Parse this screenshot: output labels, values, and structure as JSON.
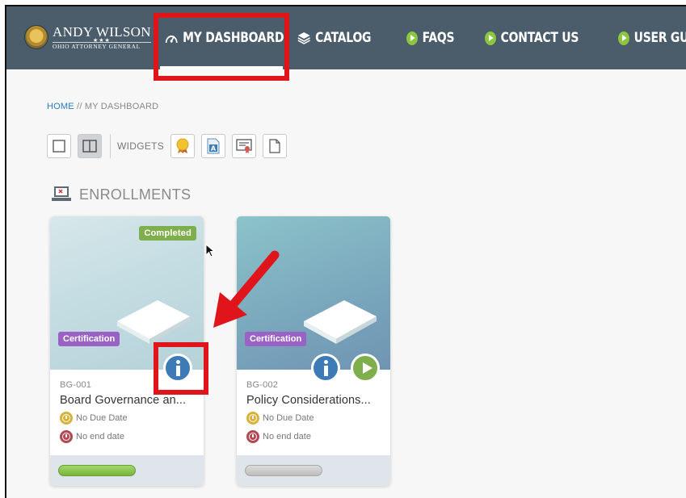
{
  "header": {
    "logo_name": "ANDY WILSON",
    "logo_stars": "★★★",
    "logo_subtitle": "OHIO ATTORNEY GENERAL",
    "nav": {
      "dashboard": "MY DASHBOARD",
      "catalog": "CATALOG",
      "faqs": "FAQS",
      "contact": "CONTACT US",
      "guide": "USER GUIDE"
    }
  },
  "breadcrumb": {
    "home": "HOME",
    "separator": " // ",
    "current": "MY DASHBOARD"
  },
  "toolbar": {
    "widgets_label": "WIDGETS"
  },
  "section": {
    "title": "ENROLLMENTS"
  },
  "cards": [
    {
      "status_badge": "Completed",
      "type_badge": "Certification",
      "code": "BG-001",
      "title": "Board Governance an...",
      "due": "No Due Date",
      "end": "No end date",
      "progress": 1.0
    },
    {
      "type_badge": "Certification",
      "code": "BG-002",
      "title": "Policy Considerations...",
      "due": "No Due Date",
      "end": "No end date",
      "progress": 0.0
    }
  ],
  "colors": {
    "nav_bg": "#4b5d6b",
    "highlight": "#e0141b",
    "completed": "#7fae4d",
    "certification": "#9a62c4",
    "info": "#3d7bb6"
  }
}
